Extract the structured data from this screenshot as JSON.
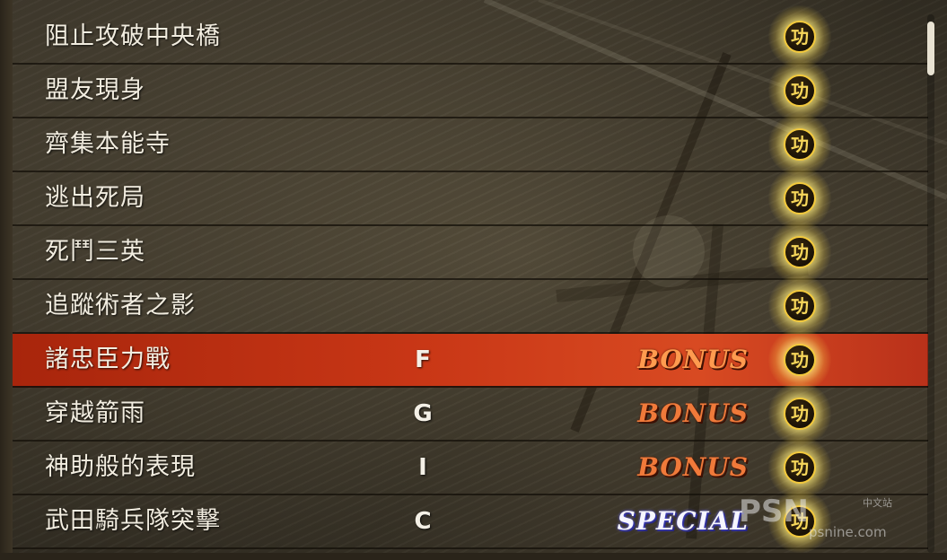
{
  "rows": [
    {
      "title": "阻止攻破中央橋",
      "rank": "",
      "bonus": "",
      "bonus_type": "",
      "medal": "功"
    },
    {
      "title": "盟友現身",
      "rank": "",
      "bonus": "",
      "bonus_type": "",
      "medal": "功"
    },
    {
      "title": "齊集本能寺",
      "rank": "",
      "bonus": "",
      "bonus_type": "",
      "medal": "功"
    },
    {
      "title": "逃出死局",
      "rank": "",
      "bonus": "",
      "bonus_type": "",
      "medal": "功"
    },
    {
      "title": "死鬥三英",
      "rank": "",
      "bonus": "",
      "bonus_type": "",
      "medal": "功"
    },
    {
      "title": "追蹤術者之影",
      "rank": "",
      "bonus": "",
      "bonus_type": "",
      "medal": "功"
    },
    {
      "title": "諸忠臣力戰",
      "rank": "F",
      "bonus": "BONUS",
      "bonus_type": "bonus",
      "medal": "功",
      "selected": true
    },
    {
      "title": "穿越箭雨",
      "rank": "G",
      "bonus": "BONUS",
      "bonus_type": "bonus",
      "medal": "功"
    },
    {
      "title": "神助般的表現",
      "rank": "I",
      "bonus": "BONUS",
      "bonus_type": "bonus",
      "medal": "功"
    },
    {
      "title": "武田騎兵隊突擊",
      "rank": "C",
      "bonus": "SPECIAL",
      "bonus_type": "special",
      "medal": "功"
    }
  ],
  "scroll_position": 0.0,
  "watermark": {
    "logo": "PSN",
    "cn": "中文站",
    "url": "psnine.com"
  },
  "colors": {
    "selected_row": "#c93716",
    "bonus_text": "#f07a3a",
    "special_text": "#f6f6ff",
    "medal_gold": "#f3c93c"
  }
}
